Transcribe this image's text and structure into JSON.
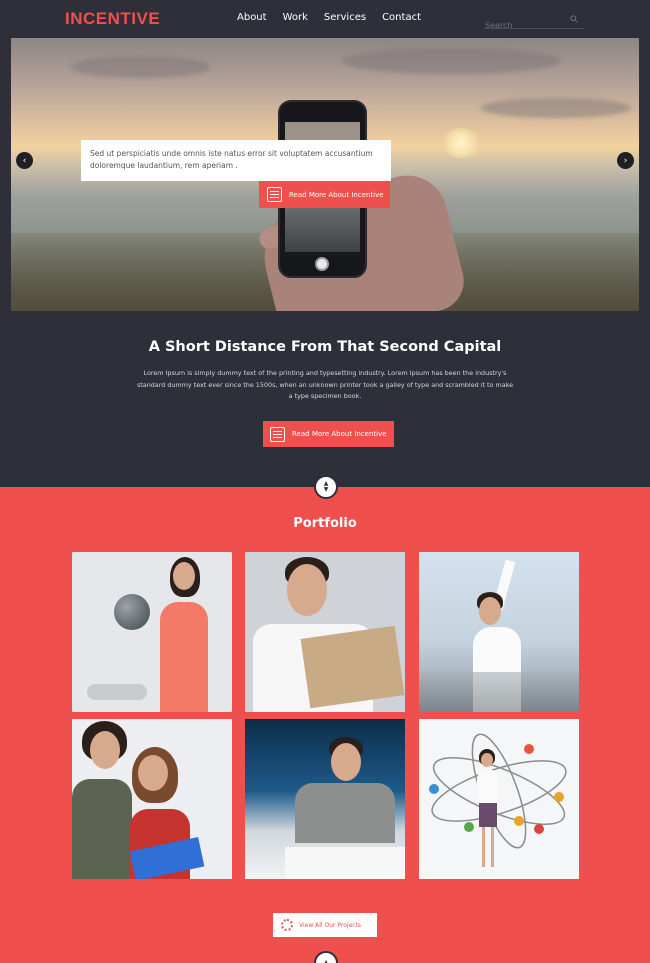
{
  "nav": {
    "logo": "INCENTIVE",
    "links": [
      "About",
      "Work",
      "Services",
      "Contact"
    ],
    "search_placeholder": "Search"
  },
  "hero": {
    "caption": "Sed ut perspiciatis unde omnis iste natus error sit voluptatem accusantium doloremque laudantium, rem aperiam .",
    "button_label": "Read More About Incentive",
    "prev_arrow": "‹",
    "next_arrow": "›"
  },
  "intro": {
    "title": "A Short Distance From That Second Capital",
    "text": "Lorem Ipsum is simply dummy text of the printing and typesetting industry. Lorem Ipsum has been the industry's standard dummy text ever since the 1500s, when an unknown printer took a galley of type and scrambled it to make a type specimen book.",
    "button_label": "Read More About Incentive"
  },
  "portfolio": {
    "title": "Portfolio",
    "view_all_label": "View All Our Projects"
  },
  "colors": {
    "accent": "#f0504d",
    "dark": "#2e2f38",
    "white": "#ffffff"
  }
}
